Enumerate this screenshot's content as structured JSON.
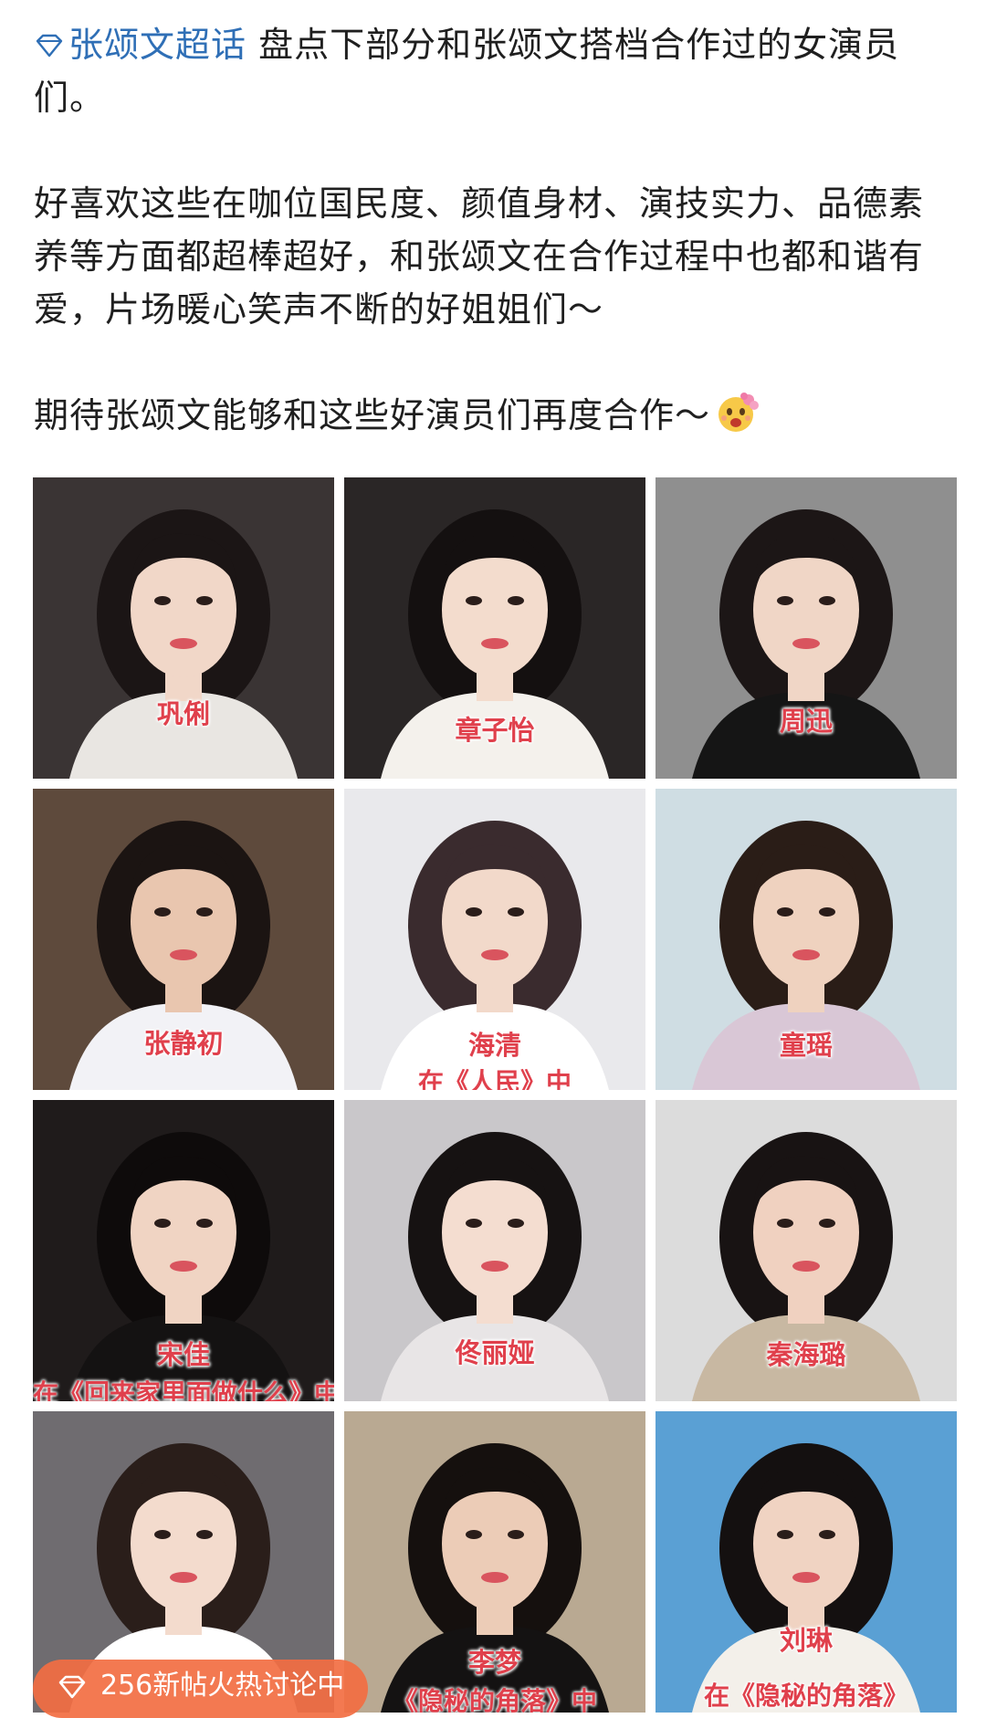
{
  "post": {
    "topic_label": "张颂文超话",
    "line1_rest": "  盘点下部分和张颂文搭档合作过的女演员们。",
    "para2": "好喜欢这些在咖位国民度、颜值身材、演技实力、品德素养等方面都超棒超好，和张颂文在合作过程中也都和谐有爱，片场暖心笑声不断的好姐姐们～",
    "para3": "期待张颂文能够和这些好演员们再度合作～",
    "emoji_icon": "flower-smile-emoji-icon"
  },
  "photos": [
    {
      "name": "巩俐",
      "bg": "#3a3434",
      "skin": "#f1d7c8",
      "hair": "#1b1515",
      "top": "#e9e6e2"
    },
    {
      "name": "章子怡",
      "bg": "#2a2626",
      "skin": "#f3dccd",
      "hair": "#141010",
      "top": "#f4f1ec"
    },
    {
      "name": "周迅",
      "bg": "#8f8f8f",
      "skin": "#f0d6c6",
      "hair": "#1c1616",
      "top": "#151515"
    },
    {
      "name": "张静初",
      "bg": "#5e4a3c",
      "skin": "#e9c6af",
      "hair": "#1b1412",
      "top": "#f2f2f6"
    },
    {
      "name": "海清",
      "bg": "#e9e9ec",
      "skin": "#f2d9ca",
      "hair": "#3a2b2e",
      "top": "#ffffff"
    },
    {
      "name": "童瑶",
      "bg": "#cfdde3",
      "skin": "#efd2bf",
      "hair": "#2a1d17",
      "top": "#d9c7d6"
    },
    {
      "name": "宋佳",
      "bg": "#1f1b1b",
      "skin": "#f0d4c3",
      "hair": "#0e0b0b",
      "top": "#141212"
    },
    {
      "name": "佟丽娅",
      "bg": "#c9c7ca",
      "skin": "#f4ddd0",
      "hair": "#161212",
      "top": "#e8e5e6"
    },
    {
      "name": "秦海璐",
      "bg": "#dcdcdc",
      "skin": "#f0d1c0",
      "hair": "#181313",
      "top": "#c8b8a2"
    },
    {
      "name": "",
      "bg": "#6f6c70",
      "skin": "#f3dbcd",
      "hair": "#2a1e1a",
      "top": "#ffffff"
    },
    {
      "name": "李梦",
      "bg": "#b9a992",
      "skin": "#ecccb7",
      "hair": "#15100e",
      "top": "#141212"
    },
    {
      "name": "刘琳",
      "bg": "#5aa0d4",
      "skin": "#f0d3c2",
      "hair": "#141010",
      "top": "#f3f0ea"
    }
  ],
  "captions": {
    "haiqing_sub": "在《人民》中",
    "songjia_sub": "在《回来家里面做什么》中",
    "limeng_sub": "《隐秘的角落》中",
    "liulin_sub": "在《隐秘的角落》"
  },
  "hot_pill": {
    "label": "256新帖火热讨论中",
    "icon": "gem-icon",
    "color": "#f26e42"
  },
  "colors": {
    "topic": "#2f6fb6",
    "name_label": "#e0404c"
  }
}
